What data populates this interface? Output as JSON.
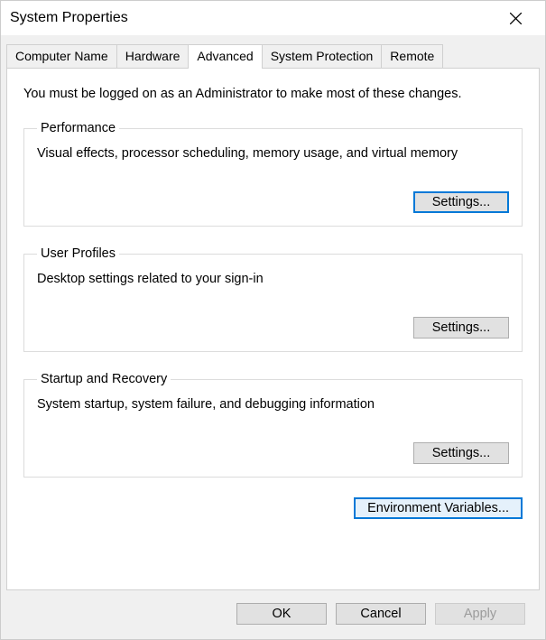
{
  "window": {
    "title": "System Properties"
  },
  "tabs": {
    "computer_name": "Computer Name",
    "hardware": "Hardware",
    "advanced": "Advanced",
    "system_protection": "System Protection",
    "remote": "Remote"
  },
  "panel": {
    "admin_note": "You must be logged on as an Administrator to make most of these changes.",
    "performance": {
      "legend": "Performance",
      "desc": "Visual effects, processor scheduling, memory usage, and virtual memory",
      "button": "Settings..."
    },
    "user_profiles": {
      "legend": "User Profiles",
      "desc": "Desktop settings related to your sign-in",
      "button": "Settings..."
    },
    "startup": {
      "legend": "Startup and Recovery",
      "desc": "System startup, system failure, and debugging information",
      "button": "Settings..."
    },
    "env_button": "Environment Variables..."
  },
  "footer": {
    "ok": "OK",
    "cancel": "Cancel",
    "apply": "Apply"
  }
}
